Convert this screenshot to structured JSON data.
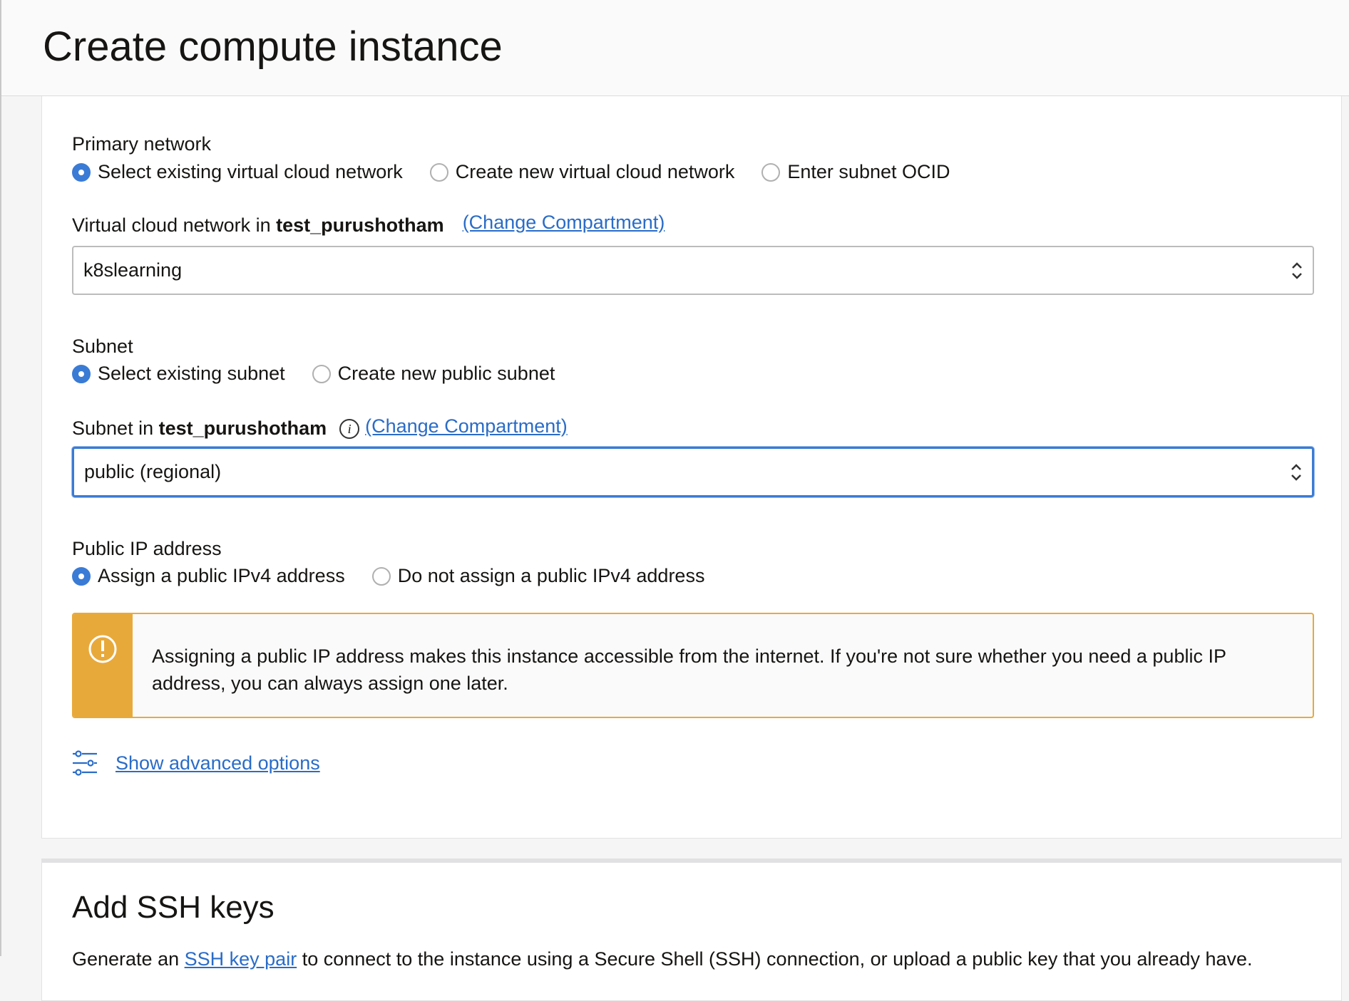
{
  "header": {
    "title": "Create compute instance"
  },
  "primary_network": {
    "label": "Primary network",
    "options": [
      "Select existing virtual cloud network",
      "Create new virtual cloud network",
      "Enter subnet OCID"
    ],
    "selected": 0
  },
  "vcn": {
    "label_prefix": "Virtual cloud network in ",
    "compartment": "test_purushotham",
    "change_link": "(Change Compartment)",
    "value": "k8slearning"
  },
  "subnet": {
    "label": "Subnet",
    "options": [
      "Select existing subnet",
      "Create new public subnet"
    ],
    "selected": 0,
    "field_label_prefix": "Subnet in ",
    "compartment": "test_purushotham",
    "change_link": "(Change Compartment)",
    "value": "public (regional)"
  },
  "public_ip": {
    "label": "Public IP address",
    "options": [
      "Assign a public IPv4 address",
      "Do not assign a public IPv4 address"
    ],
    "selected": 0,
    "warning": "Assigning a public IP address makes this instance accessible from the internet. If you're not sure whether you need a public IP address, you can always assign one later."
  },
  "advanced_link": "Show advanced options",
  "ssh": {
    "title": "Add SSH keys",
    "desc_prefix": "Generate an ",
    "desc_link": "SSH key pair",
    "desc_suffix": " to connect to the instance using a Secure Shell (SSH) connection, or upload a public key that you already have."
  },
  "colors": {
    "accent": "#3a7bd5",
    "link": "#2a6cc7",
    "warning": "#e8a93b"
  }
}
